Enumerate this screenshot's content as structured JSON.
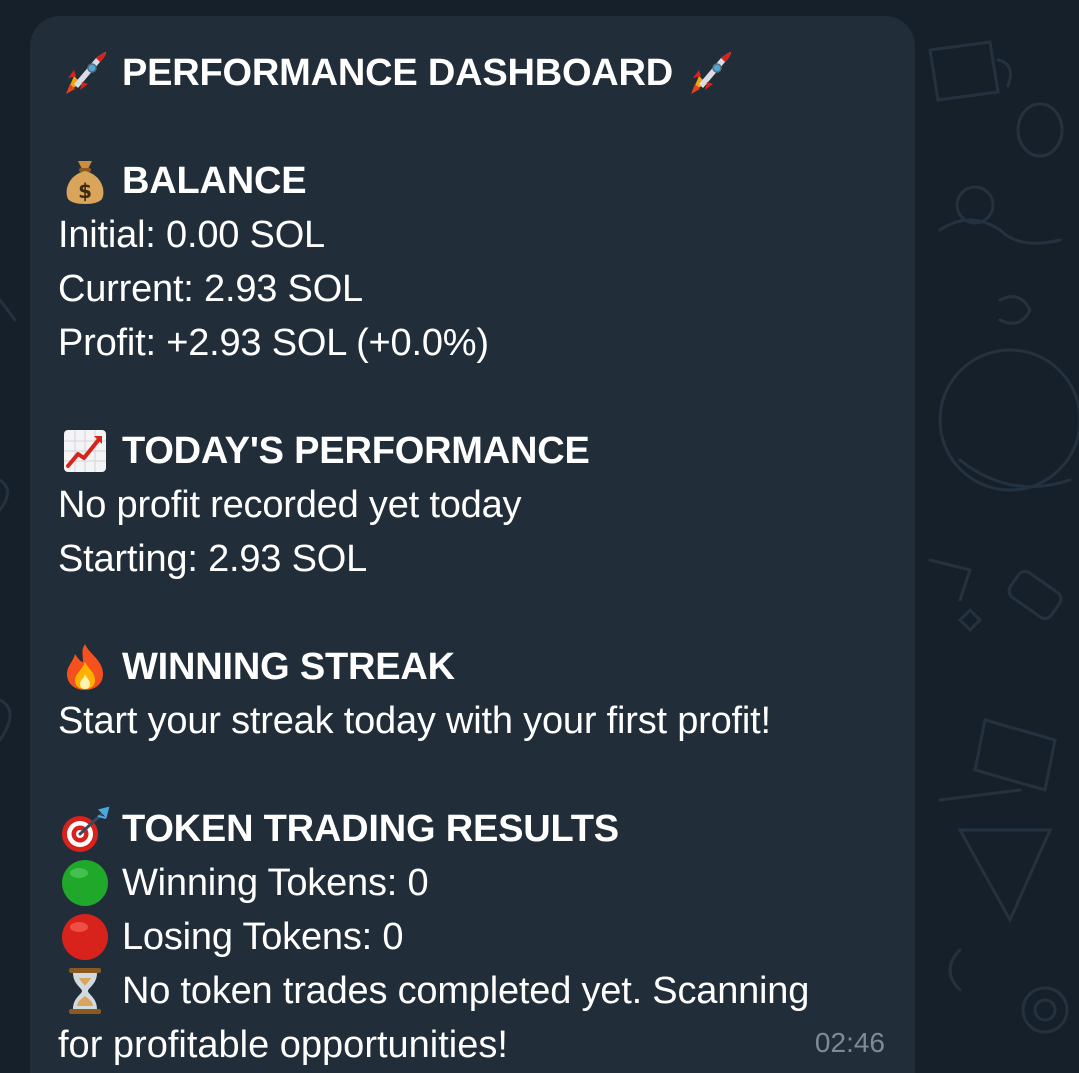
{
  "colors": {
    "background": "#16202b",
    "bubble": "#222d3a",
    "text": "#ffffff",
    "timestamp": "#7d8b99",
    "green": "#1fa82a",
    "red": "#d8231c"
  },
  "message": {
    "title": "PERFORMANCE DASHBOARD",
    "title_icon": "rocket-icon",
    "balance": {
      "icon": "money-bag-icon",
      "heading": "BALANCE",
      "initial": "Initial: 0.00 SOL",
      "current": "Current: 2.93 SOL",
      "profit": "Profit: +2.93 SOL (+0.0%)"
    },
    "today": {
      "icon": "chart-increasing-icon",
      "heading": "TODAY'S PERFORMANCE",
      "status": "No profit recorded yet today",
      "starting": "Starting: 2.93 SOL"
    },
    "streak": {
      "icon": "fire-icon",
      "heading": "WINNING STREAK",
      "text": "Start your streak today with your first profit!"
    },
    "tokens": {
      "icon": "direct-hit-icon",
      "heading": "TOKEN TRADING RESULTS",
      "winning": "Winning Tokens: 0",
      "winning_icon": "green-circle-icon",
      "losing": "Losing Tokens: 0",
      "losing_icon": "red-circle-icon",
      "status_icon": "hourglass-icon",
      "status_line1": "No token trades completed yet. Scanning",
      "status_line2": "for profitable opportunities!"
    },
    "timestamp": "02:46"
  }
}
